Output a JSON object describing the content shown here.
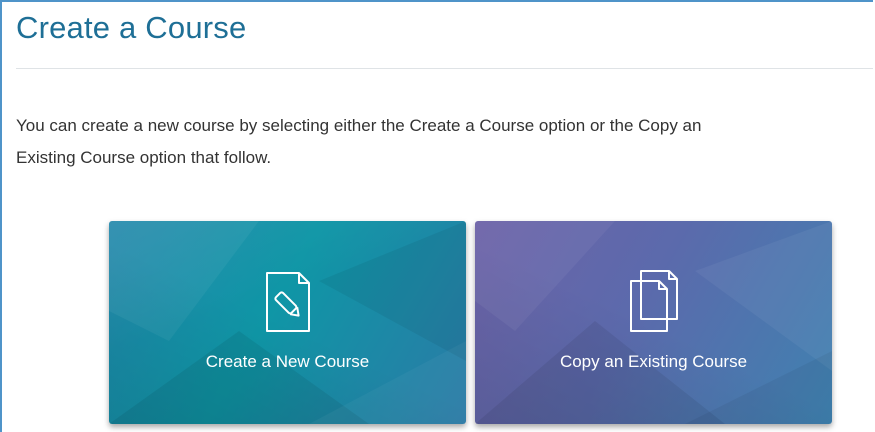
{
  "page": {
    "title": "Create a Course",
    "intro_line_1": "You can create a new course by selecting either the Create a Course option or the Copy an",
    "intro_line_2": "Existing Course option that follow."
  },
  "options": {
    "create_new": {
      "label": "Create a New Course",
      "icon": "document-pencil-icon"
    },
    "copy_existing": {
      "label": "Copy an Existing Course",
      "icon": "copy-pages-icon"
    }
  },
  "colors": {
    "title": "#1e6f96",
    "frame_border": "#4f94c9",
    "create_tile": "#0f96a6",
    "copy_tile": "#5b6aac"
  }
}
